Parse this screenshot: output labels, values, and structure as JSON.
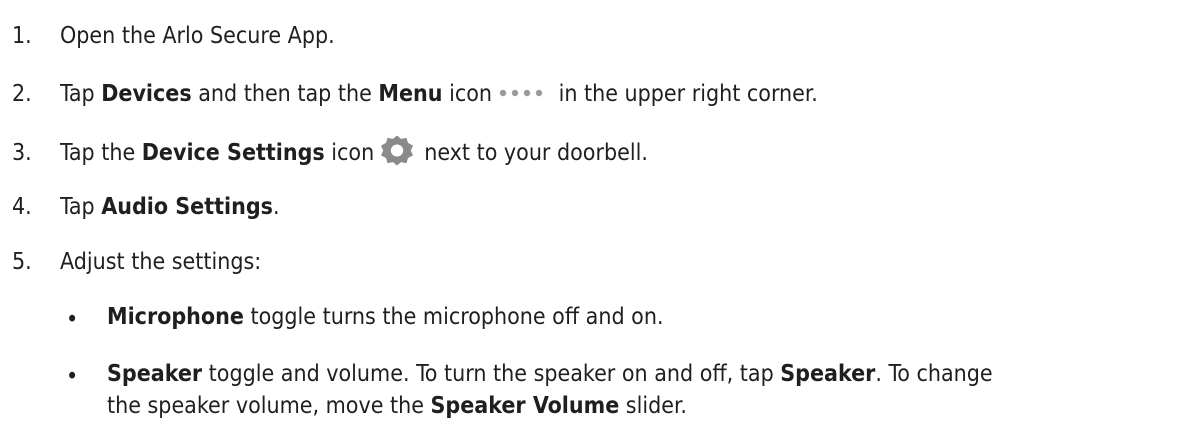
{
  "steps": [
    {
      "num": "1.",
      "text": "Open the Arlo Secure App."
    },
    {
      "num": "2.",
      "pre": "Tap ",
      "b1": "Devices",
      "mid": " and then tap the ",
      "b2": "Menu",
      "post_icon": " icon",
      "after": " in the  upper right corner.",
      "icon": "menu-dots-icon"
    },
    {
      "num": "3.",
      "pre": "Tap the ",
      "b1": "Device Settings",
      "post_icon": " icon",
      "after": "next to your doorbell.",
      "icon": "gear-icon"
    },
    {
      "num": "4.",
      "pre": "Tap ",
      "b1": "Audio Settings",
      "after": "."
    },
    {
      "num": "5.",
      "text": "Adjust the settings:"
    }
  ],
  "bullets": [
    {
      "b1": "Microphone",
      "text": " toggle turns the microphone off and on."
    },
    {
      "b1": "Speaker",
      "t1": " toggle and volume. To turn the speaker on and off, tap ",
      "b2": "Speaker",
      "t2": ". To change",
      "line2_pre": "the speaker volume, move the ",
      "line2_b": "Speaker Volume",
      "line2_post": " slider."
    }
  ],
  "colors": {
    "text": "#1f1f1f",
    "dots_icon": "#9a9a9a",
    "gear_icon": "#8a8a8a"
  }
}
